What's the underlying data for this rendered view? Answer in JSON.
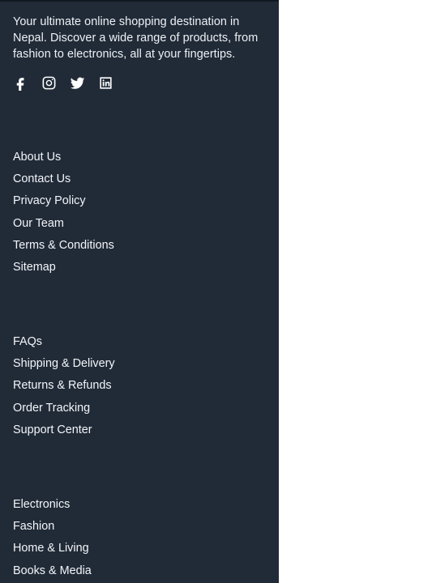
{
  "footer": {
    "about_text": "Your ultimate online shopping destination in Nepal. Discover a wide range of products, from fashion to electronics, all at your fingertips.",
    "background_color": "#212b38",
    "social": [
      {
        "icon": "facebook-icon"
      },
      {
        "icon": "instagram-icon"
      },
      {
        "icon": "twitter-icon"
      },
      {
        "icon": "linkedin-icon"
      }
    ],
    "company_links": [
      "About Us",
      "Contact Us",
      "Privacy Policy",
      "Our Team",
      "Terms & Conditions",
      "Sitemap"
    ],
    "support_links": [
      "FAQs",
      "Shipping & Delivery",
      "Returns & Refunds",
      "Order Tracking",
      "Support Center"
    ],
    "category_links": [
      "Electronics",
      "Fashion",
      "Home & Living",
      "Books & Media"
    ]
  }
}
